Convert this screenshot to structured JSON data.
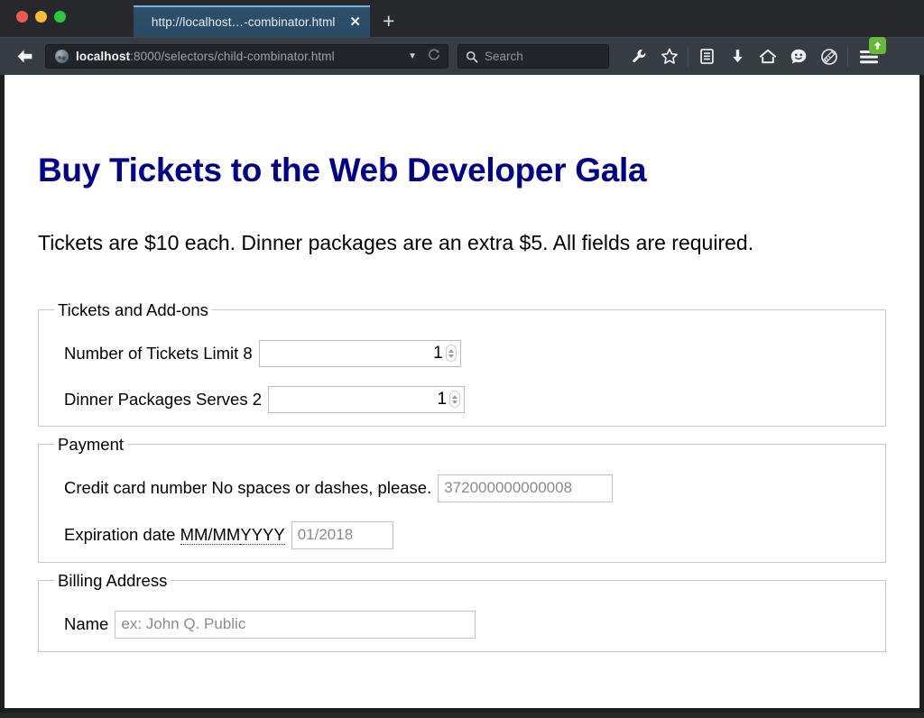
{
  "browser": {
    "window_controls": [
      "close",
      "minimize",
      "zoom"
    ],
    "tab": {
      "title": "http://localhost…-combinator.html",
      "close_label": "✕"
    },
    "new_tab_label": "+",
    "url": {
      "host": "localhost",
      "rest": ":8000/selectors/child-combinator.html",
      "dropdown_icon": "chevron-down-icon",
      "reload_icon": "reload-icon",
      "favicon": "globe-icon"
    },
    "search": {
      "placeholder": "Search",
      "icon": "search-icon"
    },
    "toolbar_icons": [
      "wrench-icon",
      "star-icon",
      "reader-list-icon",
      "download-icon",
      "home-icon",
      "smiley-face-icon",
      "pocket-icon"
    ],
    "menu_icon": "hamburger-menu-icon",
    "update_badge_icon": "update-arrow-icon",
    "back_icon": "back-arrow-icon",
    "accent_blue": "#2a4b64",
    "chrome_dark": "#373c43",
    "badge_green": "#68b839"
  },
  "page": {
    "title": "Buy Tickets to the Web Developer Gala",
    "title_color": "#00008b",
    "intro": "Tickets are $10 each. Dinner packages are an extra $5. All fields are required.",
    "fieldsets": [
      {
        "legend": "Tickets and Add-ons",
        "rows": [
          {
            "label": "Number of Tickets Limit 8",
            "label_main": "Number of Tickets",
            "label_hint": "Limit 8",
            "type": "number",
            "value": "1"
          },
          {
            "label": "Dinner Packages Serves 2",
            "label_main": "Dinner Packages",
            "label_hint": "Serves 2",
            "type": "number",
            "value": "1"
          }
        ]
      },
      {
        "legend": "Payment",
        "rows": [
          {
            "label": "Credit card number No spaces or dashes, please.",
            "label_main": "Credit card number",
            "label_hint": "No spaces or dashes, please.",
            "type": "text",
            "placeholder": "372000000000008"
          },
          {
            "label": "Expiration date MM/MMYYYY",
            "label_main": "Expiration date",
            "abbr_1": "MM/MM",
            "abbr_2": "YYYY",
            "type": "text",
            "placeholder": "01/2018"
          }
        ]
      },
      {
        "legend": "Billing Address",
        "rows": [
          {
            "label": "Name",
            "label_main": "Name",
            "type": "text",
            "placeholder": "ex: John Q. Public"
          }
        ]
      }
    ]
  }
}
